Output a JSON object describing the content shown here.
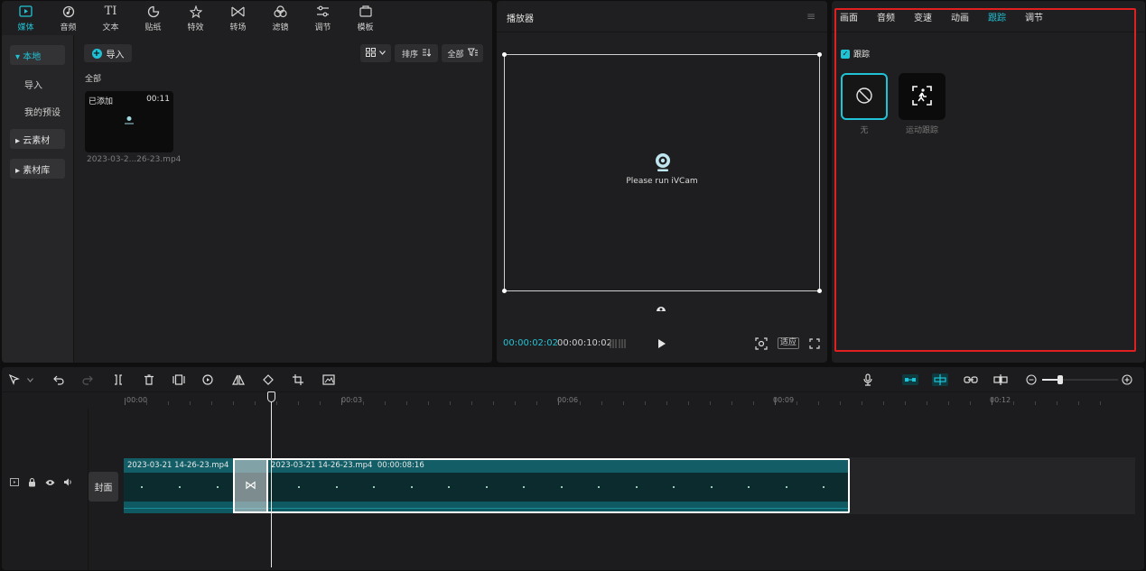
{
  "media_panel": {
    "tabs": [
      {
        "label": "媒体",
        "icon": "media-icon",
        "active": true
      },
      {
        "label": "音频",
        "icon": "audio-icon"
      },
      {
        "label": "文本",
        "icon": "text-icon"
      },
      {
        "label": "贴纸",
        "icon": "sticker-icon"
      },
      {
        "label": "特效",
        "icon": "effects-icon"
      },
      {
        "label": "转场",
        "icon": "transition-icon"
      },
      {
        "label": "滤镜",
        "icon": "filter-icon"
      },
      {
        "label": "调节",
        "icon": "adjust-icon"
      },
      {
        "label": "模板",
        "icon": "template-icon"
      }
    ],
    "sidebar": {
      "local": "▾ 本地",
      "import": "导入",
      "presets": "我的预设",
      "cloud": "▸ 云素材",
      "library": "▸ 素材库"
    },
    "import_label": "导入",
    "sort_label": "排序",
    "filter_label": "全部",
    "all_label": "全部",
    "thumbnail": {
      "added": "已添加",
      "duration": "00:11",
      "name": "2023-03-2...26-23.mp4"
    }
  },
  "player": {
    "title": "播放器",
    "message": "Please run iVCam",
    "current_time": "00:00:02:02",
    "total_time": "00:00:10:02",
    "fit_label": "适应"
  },
  "properties": {
    "tabs": [
      {
        "label": "画面"
      },
      {
        "label": "音频"
      },
      {
        "label": "变速"
      },
      {
        "label": "动画"
      },
      {
        "label": "跟踪",
        "active": true
      },
      {
        "label": "调节"
      }
    ],
    "track_checkbox": "跟踪",
    "options": [
      {
        "label": "无",
        "icon": "none-icon",
        "selected": true
      },
      {
        "label": "运动跟踪",
        "icon": "motion-tracking-icon"
      }
    ],
    "accent_color": "#20c3d6",
    "highlight_color": "#e02020"
  },
  "timeline": {
    "ruler": [
      "00:00",
      "00:03",
      "00:06",
      "00:09",
      "00:12"
    ],
    "cover_label": "封面",
    "clips": [
      {
        "name": "2023-03-21 14-26-23.mp4",
        "duration": ""
      },
      {
        "name": "2023-03-21 14-26-23.mp4",
        "duration": "00:00:08:16"
      }
    ]
  }
}
